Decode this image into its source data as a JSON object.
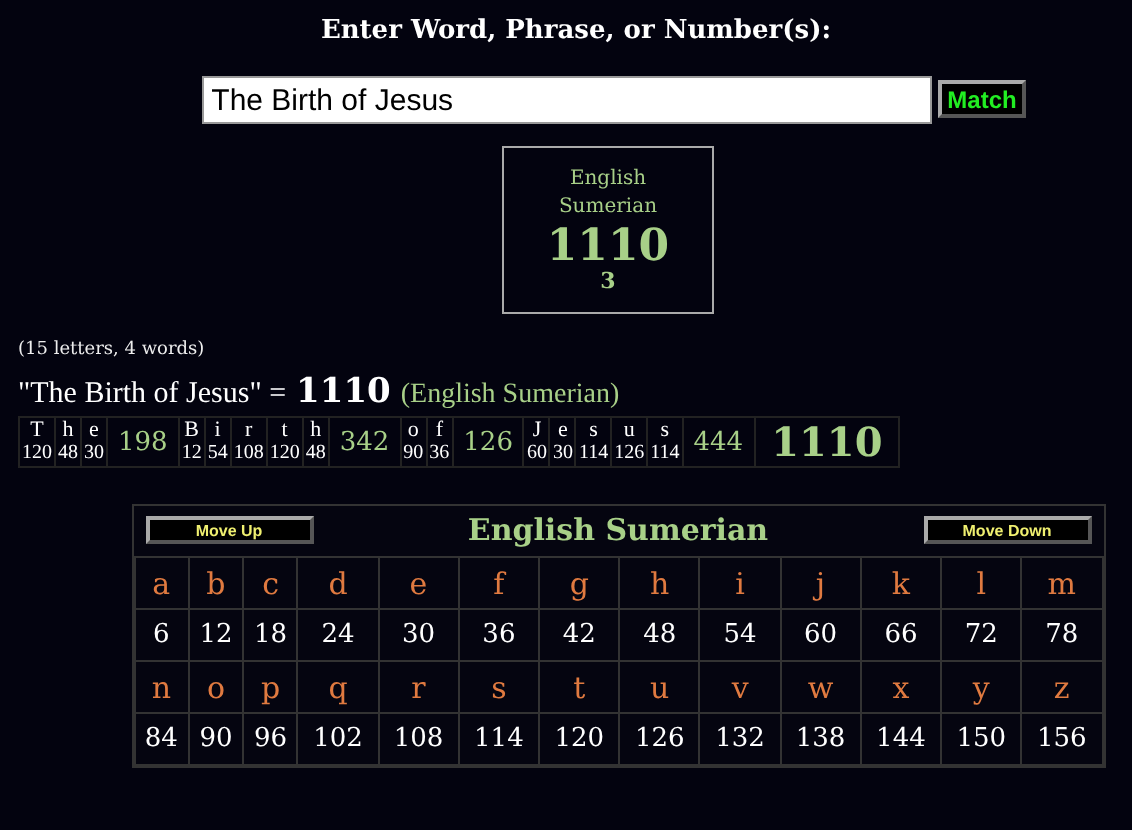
{
  "heading": "Enter Word, Phrase, or Number(s):",
  "search": {
    "value": "The Birth of Jesus"
  },
  "match_button": "Match",
  "result_box": {
    "cipher": "English Sumerian",
    "total": "1110",
    "words": "3"
  },
  "stats": "(15 letters, 4 words)",
  "equation": {
    "phrase": "\"The Birth of Jesus\" =",
    "total": "1110",
    "cipher": "(English Sumerian)"
  },
  "breakdown": {
    "words": [
      {
        "letters": [
          {
            "char": "T",
            "value": "120"
          },
          {
            "char": "h",
            "value": "48"
          },
          {
            "char": "e",
            "value": "30"
          }
        ],
        "total": "198"
      },
      {
        "letters": [
          {
            "char": "B",
            "value": "12"
          },
          {
            "char": "i",
            "value": "54"
          },
          {
            "char": "r",
            "value": "108"
          },
          {
            "char": "t",
            "value": "120"
          },
          {
            "char": "h",
            "value": "48"
          }
        ],
        "total": "342"
      },
      {
        "letters": [
          {
            "char": "o",
            "value": "90"
          },
          {
            "char": "f",
            "value": "36"
          }
        ],
        "total": "126"
      },
      {
        "letters": [
          {
            "char": "J",
            "value": "60"
          },
          {
            "char": "e",
            "value": "30"
          },
          {
            "char": "s",
            "value": "114"
          },
          {
            "char": "u",
            "value": "126"
          },
          {
            "char": "s",
            "value": "114"
          }
        ],
        "total": "444"
      }
    ],
    "total": "1110"
  },
  "cipher_table": {
    "move_up": "Move Up",
    "title": "English Sumerian",
    "move_down": "Move Down",
    "rows": [
      [
        {
          "char": "a",
          "value": "6"
        },
        {
          "char": "b",
          "value": "12"
        },
        {
          "char": "c",
          "value": "18"
        },
        {
          "char": "d",
          "value": "24"
        },
        {
          "char": "e",
          "value": "30"
        },
        {
          "char": "f",
          "value": "36"
        },
        {
          "char": "g",
          "value": "42"
        },
        {
          "char": "h",
          "value": "48"
        },
        {
          "char": "i",
          "value": "54"
        },
        {
          "char": "j",
          "value": "60"
        },
        {
          "char": "k",
          "value": "66"
        },
        {
          "char": "l",
          "value": "72"
        },
        {
          "char": "m",
          "value": "78"
        }
      ],
      [
        {
          "char": "n",
          "value": "84"
        },
        {
          "char": "o",
          "value": "90"
        },
        {
          "char": "p",
          "value": "96"
        },
        {
          "char": "q",
          "value": "102"
        },
        {
          "char": "r",
          "value": "108"
        },
        {
          "char": "s",
          "value": "114"
        },
        {
          "char": "t",
          "value": "120"
        },
        {
          "char": "u",
          "value": "126"
        },
        {
          "char": "v",
          "value": "132"
        },
        {
          "char": "w",
          "value": "138"
        },
        {
          "char": "x",
          "value": "144"
        },
        {
          "char": "y",
          "value": "150"
        },
        {
          "char": "z",
          "value": "156"
        }
      ]
    ]
  }
}
